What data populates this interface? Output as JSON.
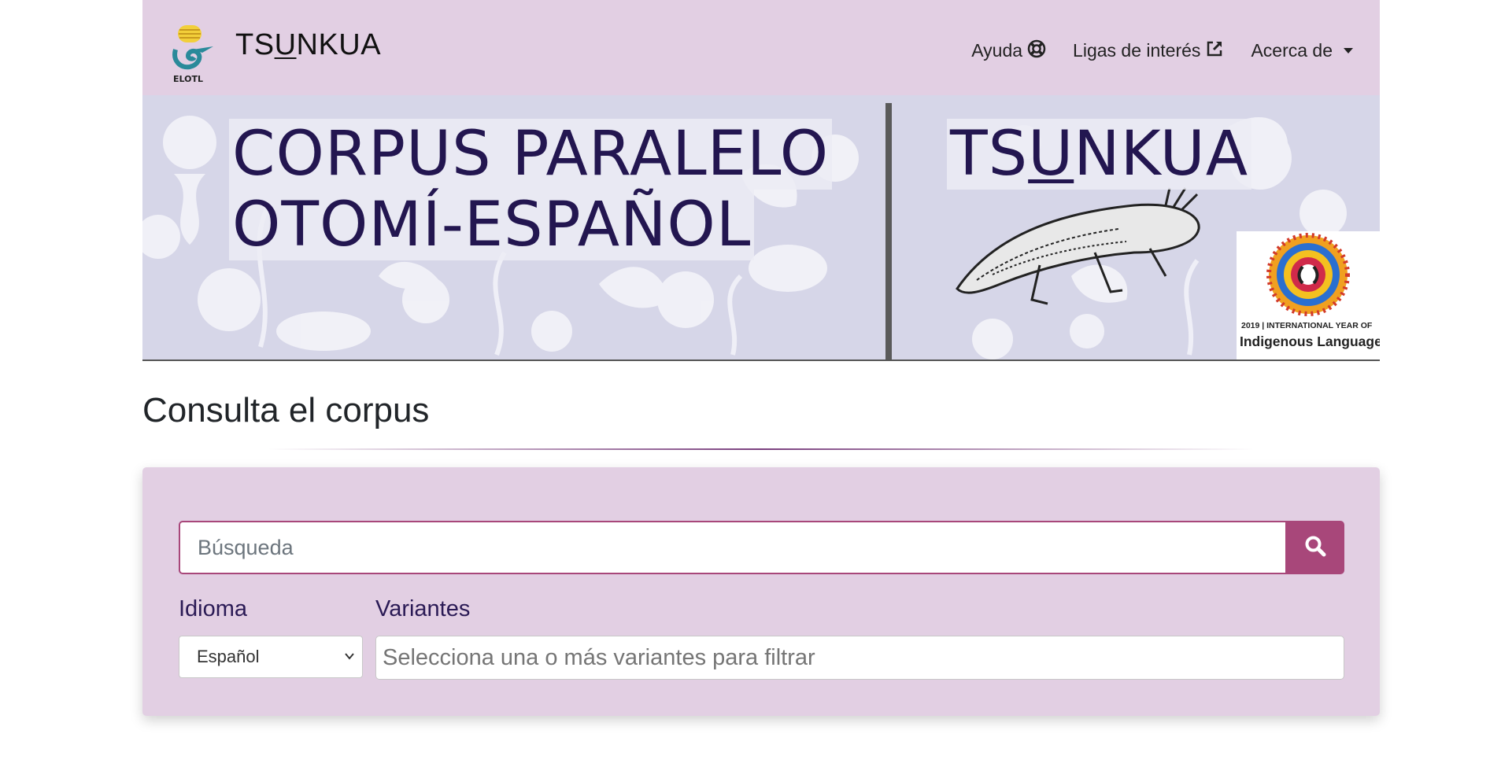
{
  "navbar": {
    "brand": "TSUNKUA",
    "brand_parts": [
      "TS",
      "U",
      "NKUA"
    ],
    "logo_caption": "ELOTL",
    "links": [
      {
        "label": "Ayuda",
        "icon": "life-ring-icon"
      },
      {
        "label": "Ligas de interés",
        "icon": "external-link-icon"
      },
      {
        "label": "Acerca de",
        "icon": "caret-down-icon"
      }
    ]
  },
  "banner": {
    "title_line1": "CORPUS PARALELO",
    "title_line2": "OTOMÍ-ESPAÑOL",
    "right_parts": [
      "TS",
      "U",
      "NKUA"
    ],
    "iyil_caption1": "2019 | INTERNATIONAL YEAR OF",
    "iyil_caption2": "Indigenous Languages"
  },
  "main": {
    "title": "Consulta el corpus",
    "search": {
      "placeholder": "Búsqueda",
      "icon": "search-icon"
    },
    "language": {
      "label": "Idioma",
      "selected": "Español"
    },
    "variants": {
      "label": "Variantes",
      "placeholder": "Selecciona una o más variantes para filtrar"
    }
  },
  "colors": {
    "navbar_bg": "#e2cfe3",
    "accent": "#a8477a",
    "banner_text": "#231650",
    "label_text": "#2a1a55"
  }
}
